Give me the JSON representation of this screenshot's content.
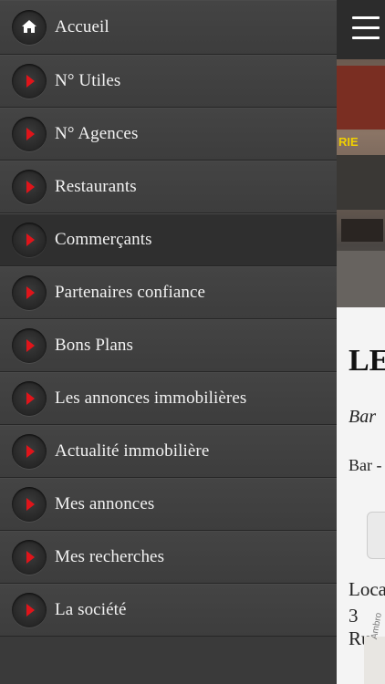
{
  "menu": {
    "items": [
      {
        "label": "Accueil",
        "icon": "home-icon",
        "active": false
      },
      {
        "label": "N° Utiles",
        "icon": "arrow-right-icon",
        "active": false
      },
      {
        "label": "N° Agences",
        "icon": "arrow-right-icon",
        "active": false
      },
      {
        "label": "Restaurants",
        "icon": "arrow-right-icon",
        "active": false
      },
      {
        "label": "Commerçants",
        "icon": "arrow-right-icon",
        "active": true
      },
      {
        "label": "Partenaires confiance",
        "icon": "arrow-right-icon",
        "active": false
      },
      {
        "label": "Bons Plans",
        "icon": "arrow-right-icon",
        "active": false
      },
      {
        "label": "Les annonces immobilières",
        "icon": "arrow-right-icon",
        "active": false
      },
      {
        "label": "Actualité immobilière",
        "icon": "arrow-right-icon",
        "active": false
      },
      {
        "label": "Mes annonces",
        "icon": "arrow-right-icon",
        "active": false
      },
      {
        "label": "Mes recherches",
        "icon": "arrow-right-icon",
        "active": false
      },
      {
        "label": "La société",
        "icon": "arrow-right-icon",
        "active": false
      }
    ]
  },
  "content": {
    "menu_icon": "hamburger-icon",
    "awning_text": "RIE",
    "title": "LE",
    "subtitle": "Bar",
    "category": "Bar -",
    "location_line1": "Loca",
    "location_line2": "3 Ru",
    "map_text": "Ambro"
  },
  "colors": {
    "arrow": "#e0141a",
    "drawer_bg": "#3a3a3a",
    "topbar": "#2c2c2c"
  }
}
